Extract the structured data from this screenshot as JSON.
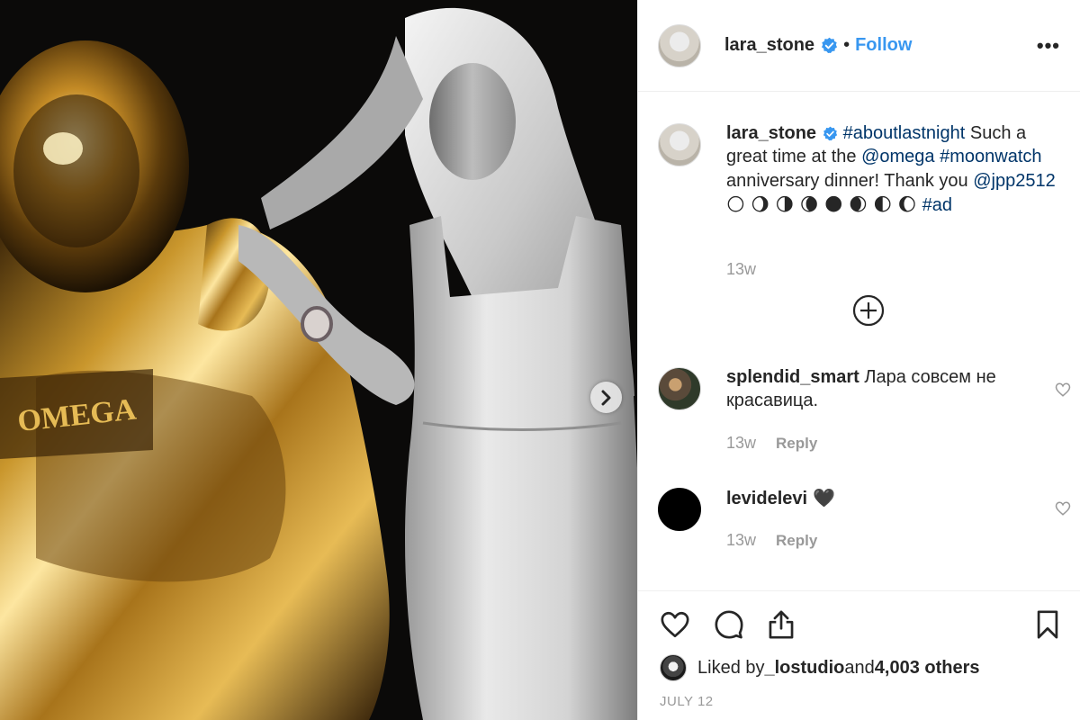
{
  "post": {
    "username": "lara_stone",
    "separator": "•",
    "follow_label": "Follow",
    "more_label": "•••"
  },
  "caption": {
    "username": "lara_stone",
    "hashtag1": "#aboutlastnight",
    "text1": " Such a great time at the ",
    "mention1": "@omega",
    "space": " ",
    "hashtag2": "#moonwatch",
    "text2": " anniversary dinner! Thank you ",
    "mention2": "@jpp2512",
    "moons": " 🌕 🌖 🌗 🌘 🌑 🌒 🌓 🌔 ",
    "hashtag3": " #ad",
    "time": "13w"
  },
  "comments": [
    {
      "username": "splendid_smart",
      "text": " Лара совсем не красавица.",
      "time": "13w",
      "reply_label": "Reply"
    },
    {
      "username": "levidelevi",
      "text": " 🖤",
      "time": "13w",
      "reply_label": "Reply"
    }
  ],
  "likes": {
    "prefix": "Liked by ",
    "liker": "_lostudio",
    "middle": " and ",
    "others": "4,003 others"
  },
  "date": "JULY 12",
  "icons": {
    "verified": "verified-badge-icon",
    "like": "heart-icon",
    "comment": "comment-icon",
    "share": "share-icon",
    "save": "bookmark-icon",
    "more": "more-options-icon",
    "load_more": "plus-circle-icon",
    "next": "chevron-right-icon"
  },
  "colors": {
    "link": "#3897f0",
    "tag": "#003569",
    "muted": "#999999"
  }
}
